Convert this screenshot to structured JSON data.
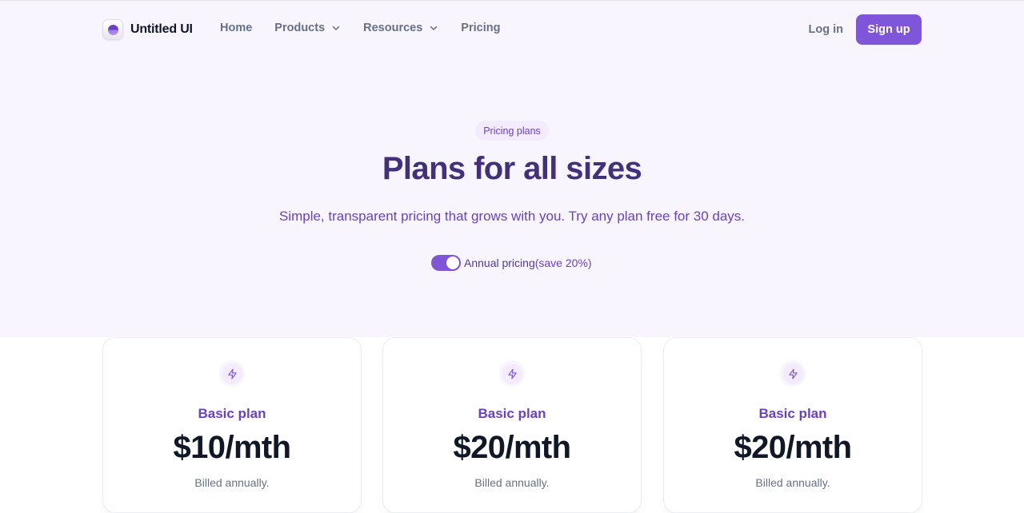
{
  "brand": {
    "name": "Untitled UI",
    "accent": "#7f56d9"
  },
  "nav": {
    "links": [
      {
        "label": "Home",
        "has_dropdown": false
      },
      {
        "label": "Products",
        "has_dropdown": true
      },
      {
        "label": "Resources",
        "has_dropdown": true
      },
      {
        "label": "Pricing",
        "has_dropdown": false
      }
    ],
    "login_label": "Log in",
    "signup_label": "Sign up"
  },
  "hero": {
    "badge": "Pricing plans",
    "title": "Plans for all sizes",
    "subtitle": "Simple, transparent pricing that grows with you. Try any plan free for 30 days.",
    "toggle": {
      "on": true,
      "label": "Annual pricing",
      "note": "(save 20%)"
    }
  },
  "plans": [
    {
      "icon": "zap-icon",
      "name": "Basic plan",
      "price": "$10/mth",
      "billing": "Billed annually."
    },
    {
      "icon": "zap-icon",
      "name": "Basic plan",
      "price": "$20/mth",
      "billing": "Billed annually."
    },
    {
      "icon": "zap-icon",
      "name": "Basic plan",
      "price": "$20/mth",
      "billing": "Billed annually."
    }
  ]
}
